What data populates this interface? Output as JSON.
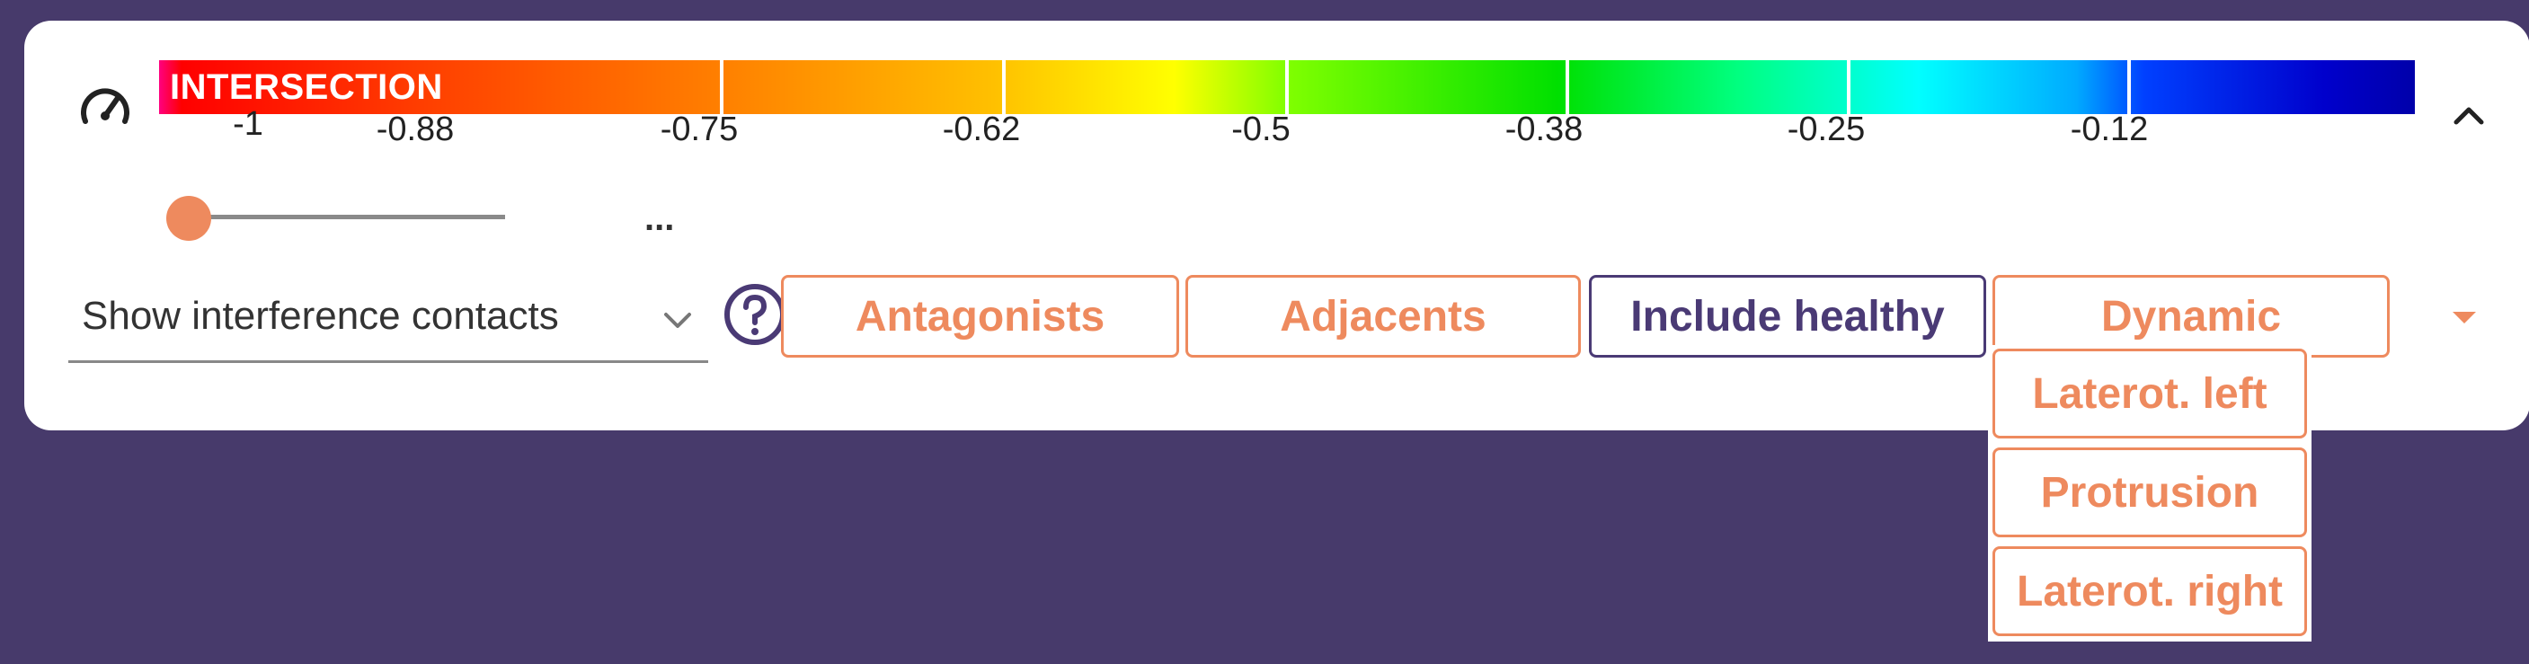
{
  "colorbar": {
    "label": "INTERSECTION",
    "ticks": [
      "-1",
      "-0.88",
      "-0.75",
      "-0.62",
      "-0.5",
      "-0.38",
      "-0.25",
      "-0.12"
    ]
  },
  "slider": {
    "value_fraction": 0.0,
    "more_label": "..."
  },
  "select": {
    "value": "Show interference contacts"
  },
  "buttons": {
    "antagonists": "Antagonists",
    "adjacents": "Adjacents",
    "include_healthy": "Include healthy",
    "dynamic": "Dynamic"
  },
  "dropdown": {
    "items": [
      "Laterot. left",
      "Protrusion",
      "Laterot. right"
    ]
  },
  "colors": {
    "background": "#473a6b",
    "accent": "#ee8a5e",
    "primary": "#4a3a75"
  },
  "icons": {
    "gauge": "speedometer-icon",
    "collapse": "chevron-up-icon",
    "select": "chevron-down-icon",
    "help": "help-circle-icon",
    "more": "caret-down-icon"
  }
}
